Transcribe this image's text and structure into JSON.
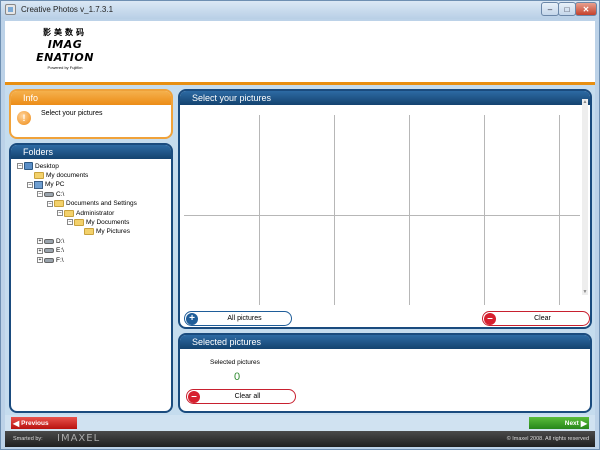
{
  "window": {
    "title": "Creative Photos v_1.7.3.1",
    "minimize_glyph": "–",
    "maximize_glyph": "□",
    "close_glyph": "✕"
  },
  "logo": {
    "chinese": "影美数码",
    "main": "IMAG ENATION",
    "sub": "Powered by Fujifilm"
  },
  "info": {
    "header": "Info",
    "icon": "info-icon",
    "text": "Select your pictures"
  },
  "folders": {
    "header": "Folders",
    "items": [
      {
        "label": "Desktop",
        "icon": "desktop-icon",
        "expander": "–"
      },
      {
        "label": "My documents",
        "icon": "folder-icon",
        "expander": ""
      },
      {
        "label": "My PC",
        "icon": "computer-icon",
        "expander": "–"
      },
      {
        "label": "C:\\",
        "icon": "drive-icon",
        "expander": "–"
      },
      {
        "label": "Documents and Settings",
        "icon": "folder-icon",
        "expander": "–"
      },
      {
        "label": "Administrator",
        "icon": "folder-icon",
        "expander": "–"
      },
      {
        "label": "My Documents",
        "icon": "folder-icon",
        "expander": "–"
      },
      {
        "label": "My Pictures",
        "icon": "folder-icon",
        "expander": ""
      },
      {
        "label": "D:\\",
        "icon": "drive-icon",
        "expander": "+"
      },
      {
        "label": "E:\\",
        "icon": "drive-icon",
        "expander": "+"
      },
      {
        "label": "F:\\",
        "icon": "drive-icon",
        "expander": "+"
      }
    ]
  },
  "select_pictures": {
    "header": "Select your pictures",
    "all_button": "All pictures",
    "clear_button": "Clear",
    "scroll_up": "▲",
    "scroll_down": "▼"
  },
  "selected": {
    "header": "Selected pictures",
    "label": "Selected pictures",
    "count": "0",
    "clear_all_button": "Clear all"
  },
  "nav": {
    "previous": "Previous",
    "next": "Next"
  },
  "footer": {
    "smarted_by": "Smarted by:",
    "brand": "IMAXEL",
    "copyright": "© Imaxel 2008. All rights reserved"
  },
  "colors": {
    "accent_orange": "#ec8c17",
    "panel_blue": "#1a4b7e",
    "clear_red": "#d6202f",
    "next_green": "#27871a",
    "count_green": "#2f8a2f"
  }
}
